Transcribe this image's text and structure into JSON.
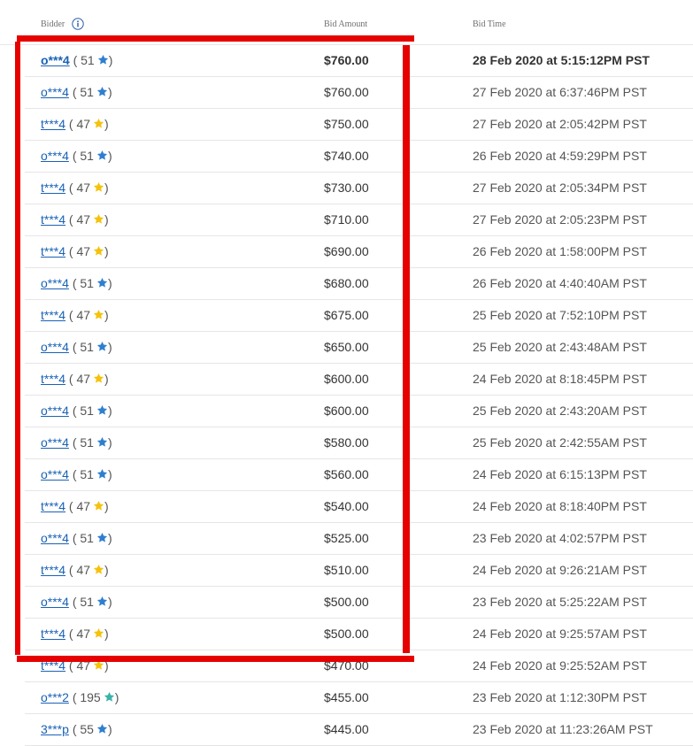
{
  "header": {
    "bidder": "Bidder",
    "bid_amount": "Bid Amount",
    "bid_time": "Bid Time"
  },
  "colors": {
    "link": "#1a62b5",
    "star_blue": "#2f7fcf",
    "star_yellow": "#f4c20d",
    "star_teal": "#3cb3a8",
    "highlight": "#e60000"
  },
  "bids": [
    {
      "bidder": "o***4",
      "score": "( 51",
      "star": "blue",
      "close": ")",
      "amount": "$760.00",
      "time": "28 Feb 2020 at 5:15:12PM PST",
      "bold": true
    },
    {
      "bidder": "o***4",
      "score": "( 51",
      "star": "blue",
      "close": ")",
      "amount": "$760.00",
      "time": "27 Feb 2020 at 6:37:46PM PST"
    },
    {
      "bidder": "t***4",
      "score": "( 47",
      "star": "yellow",
      "close": ")",
      "amount": "$750.00",
      "time": "27 Feb 2020 at 2:05:42PM PST"
    },
    {
      "bidder": "o***4",
      "score": "( 51",
      "star": "blue",
      "close": ")",
      "amount": "$740.00",
      "time": "26 Feb 2020 at 4:59:29PM PST"
    },
    {
      "bidder": "t***4",
      "score": "( 47",
      "star": "yellow",
      "close": ")",
      "amount": "$730.00",
      "time": "27 Feb 2020 at 2:05:34PM PST"
    },
    {
      "bidder": "t***4",
      "score": "( 47",
      "star": "yellow",
      "close": ")",
      "amount": "$710.00",
      "time": "27 Feb 2020 at 2:05:23PM PST"
    },
    {
      "bidder": "t***4",
      "score": "( 47",
      "star": "yellow",
      "close": ")",
      "amount": "$690.00",
      "time": "26 Feb 2020 at 1:58:00PM PST"
    },
    {
      "bidder": "o***4",
      "score": "( 51",
      "star": "blue",
      "close": ")",
      "amount": "$680.00",
      "time": "26 Feb 2020 at 4:40:40AM PST"
    },
    {
      "bidder": "t***4",
      "score": "( 47",
      "star": "yellow",
      "close": ")",
      "amount": "$675.00",
      "time": "25 Feb 2020 at 7:52:10PM PST"
    },
    {
      "bidder": "o***4",
      "score": "( 51",
      "star": "blue",
      "close": ")",
      "amount": "$650.00",
      "time": "25 Feb 2020 at 2:43:48AM PST"
    },
    {
      "bidder": "t***4",
      "score": "( 47",
      "star": "yellow",
      "close": ")",
      "amount": "$600.00",
      "time": "24 Feb 2020 at 8:18:45PM PST"
    },
    {
      "bidder": "o***4",
      "score": "( 51",
      "star": "blue",
      "close": ")",
      "amount": "$600.00",
      "time": "25 Feb 2020 at 2:43:20AM PST"
    },
    {
      "bidder": "o***4",
      "score": "( 51",
      "star": "blue",
      "close": ")",
      "amount": "$580.00",
      "time": "25 Feb 2020 at 2:42:55AM PST"
    },
    {
      "bidder": "o***4",
      "score": "( 51",
      "star": "blue",
      "close": ")",
      "amount": "$560.00",
      "time": "24 Feb 2020 at 6:15:13PM PST"
    },
    {
      "bidder": "t***4",
      "score": "( 47",
      "star": "yellow",
      "close": ")",
      "amount": "$540.00",
      "time": "24 Feb 2020 at 8:18:40PM PST"
    },
    {
      "bidder": "o***4",
      "score": "( 51",
      "star": "blue",
      "close": ")",
      "amount": "$525.00",
      "time": "23 Feb 2020 at 4:02:57PM PST"
    },
    {
      "bidder": "t***4",
      "score": "( 47",
      "star": "yellow",
      "close": ")",
      "amount": "$510.00",
      "time": "24 Feb 2020 at 9:26:21AM PST"
    },
    {
      "bidder": "o***4",
      "score": "( 51",
      "star": "blue",
      "close": ")",
      "amount": "$500.00",
      "time": "23 Feb 2020 at 5:25:22AM PST"
    },
    {
      "bidder": "t***4",
      "score": "( 47",
      "star": "yellow",
      "close": ")",
      "amount": "$500.00",
      "time": "24 Feb 2020 at 9:25:57AM PST"
    },
    {
      "bidder": "t***4",
      "score": "( 47",
      "star": "yellow",
      "close": ")",
      "amount": "$470.00",
      "time": "24 Feb 2020 at 9:25:52AM PST"
    },
    {
      "bidder": "o***2",
      "score": "( 195",
      "star": "teal",
      "close": ")",
      "amount": "$455.00",
      "time": "23 Feb 2020 at 1:12:30PM PST"
    },
    {
      "bidder": "3***p",
      "score": "( 55",
      "star": "blue",
      "close": ")",
      "amount": "$445.00",
      "time": "23 Feb 2020 at 11:23:26AM PST"
    }
  ]
}
